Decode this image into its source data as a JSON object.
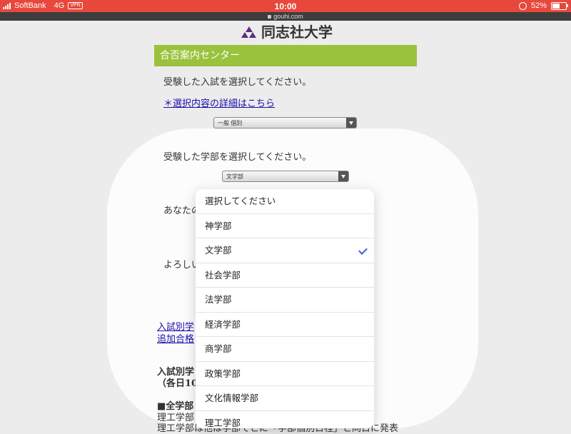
{
  "status_bar": {
    "carrier": "SoftBank",
    "network": "4G",
    "vpn": "VPN",
    "time": "10:00",
    "battery": "52%",
    "battery_level": 0.52
  },
  "browser": {
    "url": "gouhi.com"
  },
  "logo": {
    "text": "同志社大学"
  },
  "header": {
    "title": "合否案内センター"
  },
  "page": {
    "select_exam_prompt": "受験した入試を選択してください。",
    "details_link": "＊選択内容の詳細はこちら",
    "exam_select_value": "一般 個別",
    "select_faculty_prompt": "受験した学部を選択してください。",
    "faculty_select_value": "文学部",
    "partial_text_1": "あなたの",
    "partial_text_2": "よろしい",
    "link_1": "入試別学",
    "link_2": "追加合格",
    "section_1": "入試別学",
    "section_2": "（各日10",
    "section_3": "■全学部",
    "section_4": "理工学部",
    "section_5": "理工学部は他は学部でとに「学部個別日程」と同日に発表"
  },
  "dropdown": {
    "options": [
      "選択してください",
      "神学部",
      "文学部",
      "社会学部",
      "法学部",
      "経済学部",
      "商学部",
      "政策学部",
      "文化情報学部",
      "理工学部"
    ],
    "selected": "文学部"
  },
  "colors": {
    "statusbar": "#e8473b",
    "header": "#9ac23c",
    "check": "#3a5fd9",
    "logo_mark": "#5b2d7f"
  }
}
